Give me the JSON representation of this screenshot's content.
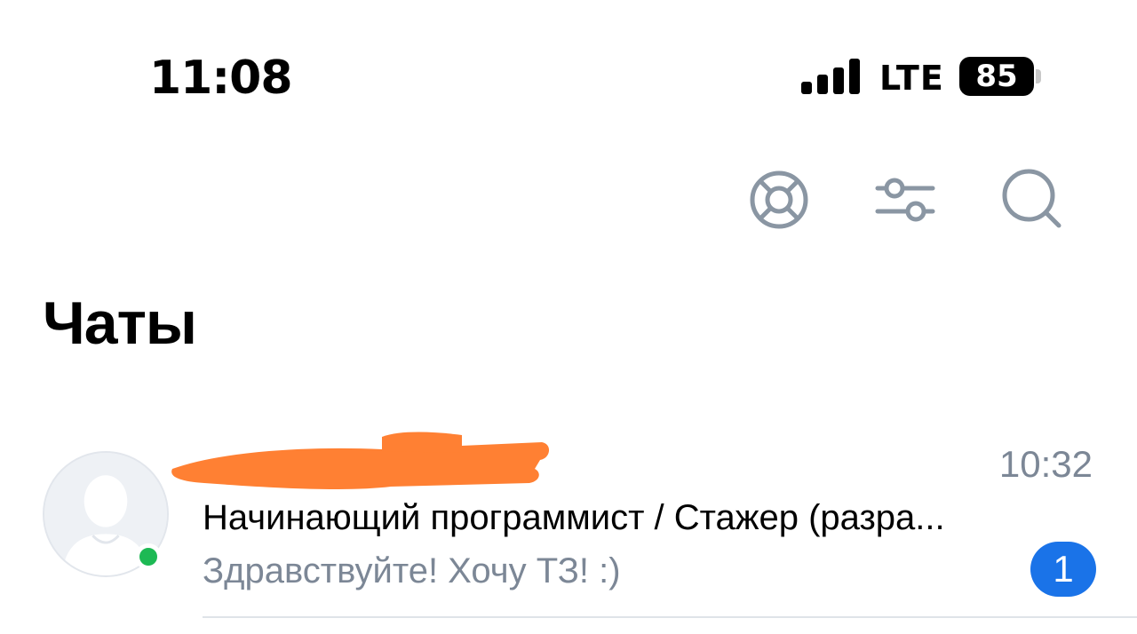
{
  "status_bar": {
    "time": "11:08",
    "network": "LTE",
    "battery": "85"
  },
  "toolbar": {
    "icons": [
      "lifebuoy-icon",
      "filter-sliders-icon",
      "search-icon"
    ],
    "icon_color": "#8a96a3"
  },
  "page": {
    "title": "Чаты"
  },
  "chats": [
    {
      "name": "",
      "time": "10:32",
      "subject": "Начинающий программист / Стажер (разра...",
      "preview": "Здравствуйте! Хочу ТЗ! :)",
      "unread": "1",
      "online": true
    }
  ],
  "colors": {
    "accent": "#1a73e8",
    "online": "#1db954",
    "muted_text": "#7c8796",
    "redaction": "#ff8033"
  }
}
